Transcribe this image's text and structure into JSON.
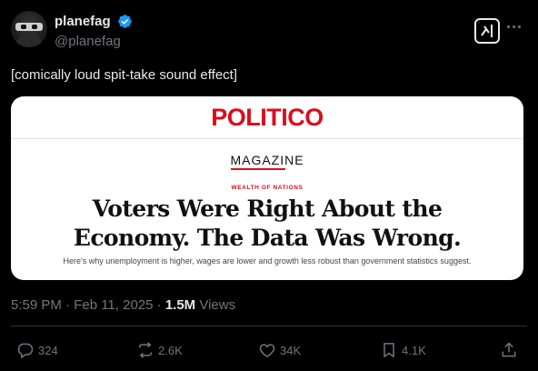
{
  "author": {
    "display_name": "planefag",
    "handle": "@planefag",
    "verified": true
  },
  "tweet": {
    "text": "[comically loud spit-take sound effect]"
  },
  "card": {
    "publication": "POLITICO",
    "section": "MAGAZINE",
    "kicker": "WEALTH OF NATIONS",
    "headline_line1": "Voters Were Right About the",
    "headline_line2": "Economy. The Data Was Wrong.",
    "dek": "Here's why unemployment is higher, wages are lower and growth less robust than government statistics suggest."
  },
  "meta": {
    "timestamp": "5:59 PM · Feb 11, 2025 · ",
    "views_count": "1.5M",
    "views_label": " Views"
  },
  "actions": {
    "replies": "324",
    "reposts": "2.6K",
    "likes": "34K",
    "bookmarks": "4.1K"
  },
  "icons": {
    "verified": "verified-badge-icon",
    "grok": "grok-icon",
    "more": "more-icon",
    "reply": "reply-icon",
    "repost": "repost-icon",
    "like": "heart-icon",
    "bookmark": "bookmark-icon",
    "share": "share-icon"
  },
  "colors": {
    "background": "#000000",
    "text": "#e7e9ea",
    "muted": "#71767b",
    "verified": "#1d9bf0",
    "politico_red": "#dc0c1c"
  }
}
